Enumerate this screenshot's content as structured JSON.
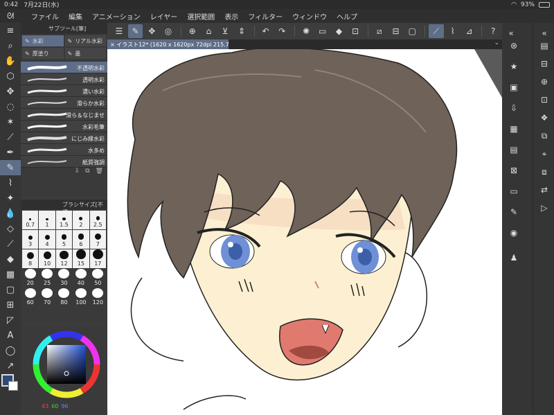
{
  "status": {
    "time": "0:42",
    "date": "7月22日(水)",
    "battery": "93%"
  },
  "menu": [
    "ファイル",
    "編集",
    "アニメーション",
    "レイヤー",
    "選択範囲",
    "表示",
    "フィルター",
    "ウィンドウ",
    "ヘルプ"
  ],
  "canvas_tab": {
    "title": "イラスト12* (1620 x 1620px 72dpi 215.7%)"
  },
  "subtool": {
    "header": "サブツール[筆]",
    "groups": [
      "水彩",
      "リアル水彩",
      "厚塗り",
      "墨"
    ],
    "brushes": [
      "不透明水彩",
      "透明水彩",
      "濃い水彩",
      "滑らか水彩",
      "滑ら＆なじませ",
      "水彩毛筆",
      "にじみ縁水彩",
      "水多め",
      "紙質強調"
    ]
  },
  "brushsize": {
    "header": "ブラシサイズ[不透",
    "sizes": [
      "0.7",
      "1",
      "1.5",
      "2",
      "2.5",
      "3",
      "4",
      "5",
      "6",
      "7",
      "8",
      "10",
      "12",
      "15",
      "17",
      "20",
      "25",
      "30",
      "40",
      "50",
      "60",
      "70",
      "80",
      "100",
      "120"
    ],
    "selected": "20"
  },
  "color": {
    "r": "43",
    "g": "60",
    "b": "96",
    "main_hex": "#2b3c60"
  }
}
